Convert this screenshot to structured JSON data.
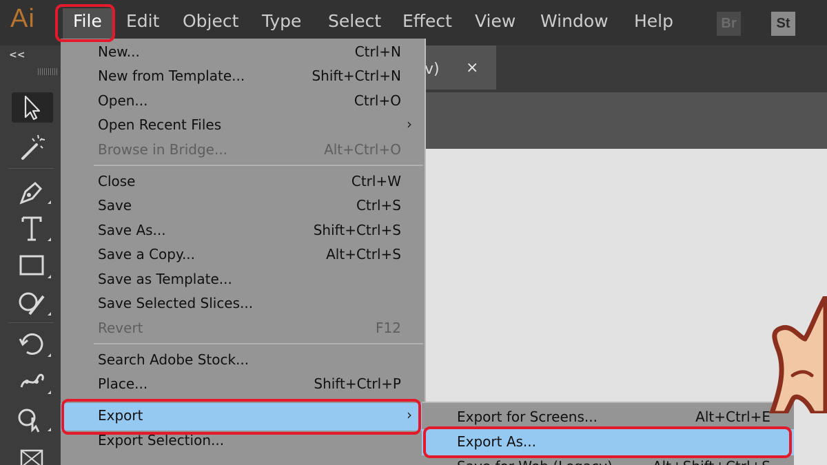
{
  "app": {
    "logo": "Ai",
    "bridge_badge": "Br",
    "stock_badge": "St"
  },
  "menubar": {
    "items": [
      "File",
      "Edit",
      "Object",
      "Type",
      "Select",
      "Effect",
      "View",
      "Window",
      "Help"
    ]
  },
  "toolbar": {
    "collapse": "<<"
  },
  "document_tab": {
    "title_visible": "v)",
    "close": "×"
  },
  "file_menu": {
    "items": [
      {
        "label": "New...",
        "shortcut": "Ctrl+N"
      },
      {
        "label": "New from Template...",
        "shortcut": "Shift+Ctrl+N"
      },
      {
        "label": "Open...",
        "shortcut": "Ctrl+O"
      },
      {
        "label": "Open Recent Files",
        "shortcut": "",
        "submenu": true
      },
      {
        "label": "Browse in Bridge...",
        "shortcut": "Alt+Ctrl+O",
        "disabled": true
      },
      {
        "label": "Close",
        "shortcut": "Ctrl+W"
      },
      {
        "label": "Save",
        "shortcut": "Ctrl+S"
      },
      {
        "label": "Save As...",
        "shortcut": "Shift+Ctrl+S"
      },
      {
        "label": "Save a Copy...",
        "shortcut": "Alt+Ctrl+S"
      },
      {
        "label": "Save as Template...",
        "shortcut": ""
      },
      {
        "label": "Save Selected Slices...",
        "shortcut": ""
      },
      {
        "label": "Revert",
        "shortcut": "F12",
        "disabled": true
      },
      {
        "label": "Search Adobe Stock...",
        "shortcut": ""
      },
      {
        "label": "Place...",
        "shortcut": "Shift+Ctrl+P"
      },
      {
        "label": "Export",
        "shortcut": "",
        "submenu": true,
        "highlighted": true
      },
      {
        "label": "Export Selection...",
        "shortcut": ""
      }
    ],
    "submenu_arrow": "›"
  },
  "export_submenu": {
    "items": [
      {
        "label": "Export for Screens...",
        "shortcut": "Alt+Ctrl+E"
      },
      {
        "label": "Export As...",
        "shortcut": "",
        "highlighted": true
      },
      {
        "label": "Save for Web (Legacy)...",
        "shortcut": "Alt+Shift+Ctrl+S"
      }
    ]
  },
  "colors": {
    "menubar_bg": "#323232",
    "menu_bg": "#959595",
    "highlight": "#96c9f2",
    "annotation_red": "#e3192c",
    "logo": "#b7732f"
  }
}
